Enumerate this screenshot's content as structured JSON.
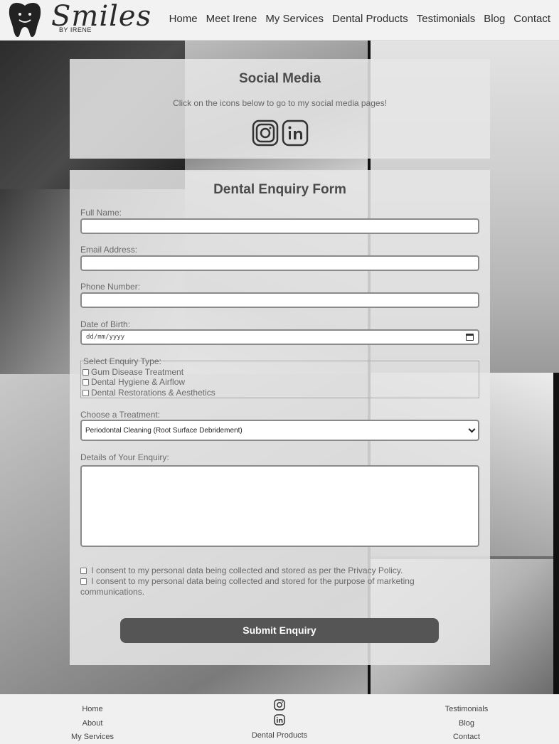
{
  "brand": {
    "logo_text": "Smiles",
    "logo_sub": "BY IRENE"
  },
  "nav": [
    "Home",
    "Meet Irene",
    "My Services",
    "Dental Products",
    "Testimonials",
    "Blog",
    "Contact"
  ],
  "social": {
    "title": "Social Media",
    "text": "Click on the icons below to go to my social media pages!",
    "icons": [
      "instagram-icon",
      "linkedin-icon"
    ]
  },
  "form": {
    "title": "Dental Enquiry Form",
    "full_name_label": "Full Name:",
    "full_name_value": "",
    "email_label": "Email Address:",
    "email_value": "",
    "phone_label": "Phone Number:",
    "phone_value": "",
    "dob_label": "Date of Birth:",
    "dob_placeholder": "dd/mm/yyyy",
    "enquiry_type_legend": "Select Enquiry Type:",
    "enquiry_types": [
      {
        "label": "Gum Disease Treatment",
        "checked": false
      },
      {
        "label": "Dental Hygiene & Airflow",
        "checked": false
      },
      {
        "label": "Dental Restorations & Aesthetics",
        "checked": false
      }
    ],
    "treatment_label": "Choose a Treatment:",
    "treatment_selected": "Periodontal Cleaning (Root Surface Debridement)",
    "details_label": "Details of Your Enquiry:",
    "details_value": "",
    "consent_1": "I consent to my personal data being collected and stored as per the Privacy Policy.",
    "consent_2": "I consent to my personal data being collected and stored for the purpose of marketing communications.",
    "submit_label": "Submit Enquiry"
  },
  "footer": {
    "left_links": [
      "Home",
      "About",
      "My Services"
    ],
    "middle_link": "Dental Products",
    "right_links": [
      "Testimonials",
      "Blog",
      "Contact"
    ]
  },
  "colors": {
    "submit_bg": "#555555",
    "panel_bg": "#e6e6e6",
    "header_bg": "#f2f2f2"
  }
}
